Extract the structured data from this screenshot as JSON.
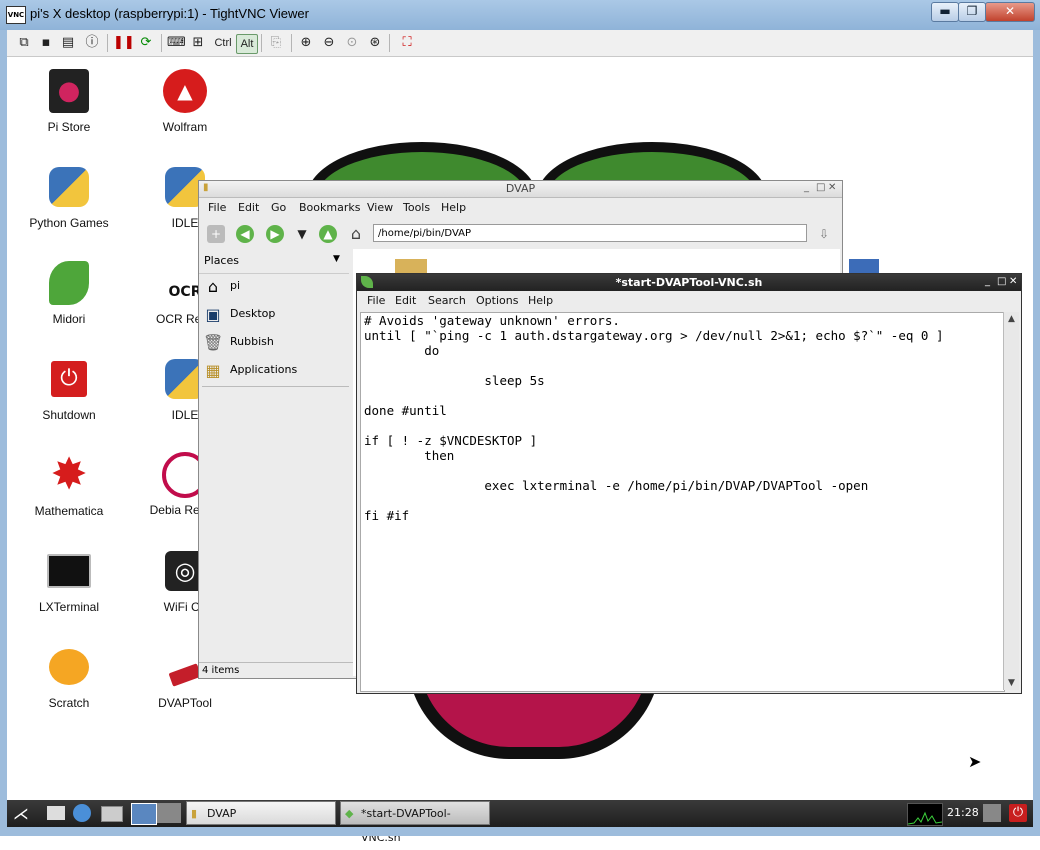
{
  "vnc_window": {
    "title": "pi's X desktop (raspberrypi:1) - TightVNC Viewer",
    "logo_text": "VNC",
    "controls": [
      "▬",
      "❐",
      "✕"
    ],
    "toolbar": {
      "ctrl_label": "Ctrl",
      "alt_label": "Alt"
    }
  },
  "desktop": {
    "icons": [
      {
        "label": "Pi Store",
        "icon": "pi-store-icon",
        "glyph": "🛍"
      },
      {
        "label": "Wolfram",
        "icon": "wolfram-icon",
        "glyph": "🐺"
      },
      {
        "label": "Python Games",
        "icon": "python-games-icon",
        "glyph": "🐍"
      },
      {
        "label": "IDLE",
        "icon": "idle-icon",
        "glyph": "🐍"
      },
      {
        "label": "Midori",
        "icon": "midori-icon",
        "glyph": "🌿"
      },
      {
        "label": "OCR Reso",
        "icon": "ocr-icon",
        "glyph": "OCR"
      },
      {
        "label": "Shutdown",
        "icon": "shutdown-icon",
        "glyph": "⏻"
      },
      {
        "label": "IDLE",
        "icon": "idle3-icon",
        "glyph": "🐍"
      },
      {
        "label": "Mathematica",
        "icon": "mathematica-icon",
        "glyph": "✷"
      },
      {
        "label": "Debia Refere",
        "icon": "debian-reference-icon",
        "glyph": "◐"
      },
      {
        "label": "LXTerminal",
        "icon": "lxterminal-icon",
        "glyph": "▭"
      },
      {
        "label": "WiFi Co",
        "icon": "wifi-config-icon",
        "glyph": "◎"
      },
      {
        "label": "Scratch",
        "icon": "scratch-icon",
        "glyph": "🐱"
      },
      {
        "label": "DVAPTool",
        "icon": "dvaptool-icon",
        "glyph": "▬"
      }
    ]
  },
  "file_manager": {
    "title": "DVAP",
    "menu": [
      "File",
      "Edit",
      "Go",
      "Bookmarks",
      "View",
      "Tools",
      "Help"
    ],
    "address": "/home/pi/bin/DVAP",
    "places_title": "Places",
    "places": [
      {
        "label": "pi",
        "glyph": "⌂"
      },
      {
        "label": "Desktop",
        "glyph": "▣"
      },
      {
        "label": "Rubbish",
        "glyph": "🗑"
      },
      {
        "label": "Applications",
        "glyph": "▦"
      }
    ],
    "status": "4 items"
  },
  "editor": {
    "title": "*start-DVAPTool-VNC.sh",
    "menu": [
      "File",
      "Edit",
      "Search",
      "Options",
      "Help"
    ],
    "code": "# Avoids 'gateway unknown' errors.\nuntil [ \"`ping -c 1 auth.dstargateway.org > /dev/null 2>&1; echo $?`\" -eq 0 ]\n        do\n\n                sleep 5s\n\ndone #until\n\nif [ ! -z $VNCDESKTOP ]\n        then\n\n                exec lxterminal -e /home/pi/bin/DVAP/DVAPTool -open\n\nfi #if"
  },
  "taskbar": {
    "tasks": [
      "DVAP",
      "*start-DVAPTool-VNC.sh"
    ],
    "clock": "21:28"
  }
}
